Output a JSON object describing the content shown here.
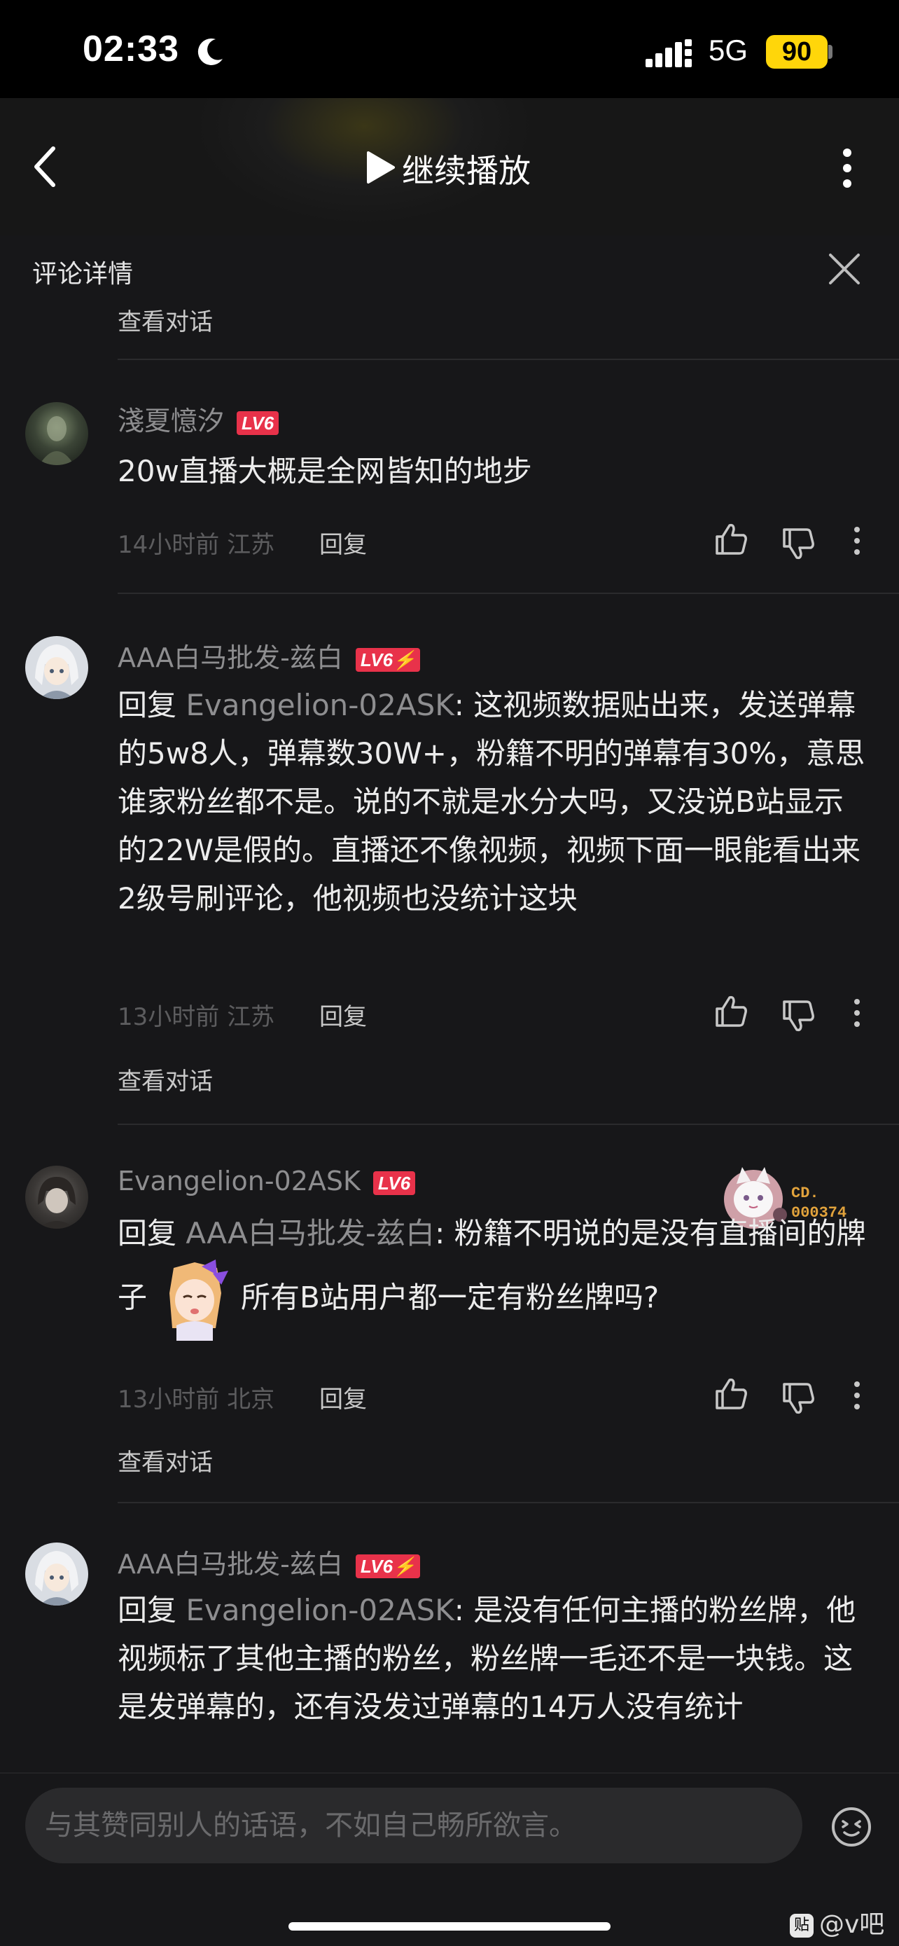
{
  "status_bar": {
    "time": "02:33",
    "network": "5G",
    "battery": "90"
  },
  "nav": {
    "title": "继续播放"
  },
  "detail": {
    "title": "评论详情"
  },
  "top": {
    "view_conversation": "查看对话"
  },
  "comments": [
    {
      "username": "淺夏憶汐",
      "level": "LV6",
      "body": "20w直播大概是全网皆知的地步",
      "time": "14小时前",
      "location": "江苏",
      "reply_label": "回复"
    },
    {
      "username": "AAA白马批发-兹白",
      "level": "LV6⚡",
      "reply_prefix": "回复 ",
      "mention": "Evangelion-02ASK",
      "body": ": 这视频数据贴出来，发送弹幕的5w8人，弹幕数30W+，粉籍不明的弹幕有30%，意思谁家粉丝都不是。说的不就是水分大吗，又没说B站显示的22W是假的。直播还不像视频，视频下面一眼能看出来2级号刷评论，他视频也没统计这块",
      "time": "13小时前",
      "location": "江苏",
      "reply_label": "回复",
      "view_conversation": "查看对话"
    },
    {
      "username": "Evangelion-02ASK",
      "level": "LV6",
      "fan_badge": {
        "line1": "CD.",
        "line2": "000374"
      },
      "reply_prefix": "回复 ",
      "mention": "AAA白马批发-兹白",
      "body_a": ": 粉籍不明说的是没有直播间的牌子",
      "body_b": "所有B站用户都一定有粉丝牌吗?",
      "time": "13小时前",
      "location": "北京",
      "reply_label": "回复",
      "view_conversation": "查看对话"
    },
    {
      "username": "AAA白马批发-兹白",
      "level": "LV6⚡",
      "reply_prefix": "回复 ",
      "mention": "Evangelion-02ASK",
      "body": ": 是没有任何主播的粉丝牌，他视频标了其他主播的粉丝，粉丝牌一毛还不是一块钱。这是发弹幕的，还有没发过弹幕的14万人没有统计"
    }
  ],
  "input": {
    "placeholder": "与其赞同别人的话语，不如自己畅所欲言。"
  },
  "watermark": {
    "logo": "贴",
    "text": "@v吧"
  },
  "colors": {
    "accent_level": "#e8324a",
    "battery": "#ffd60a",
    "background": "#171719"
  }
}
